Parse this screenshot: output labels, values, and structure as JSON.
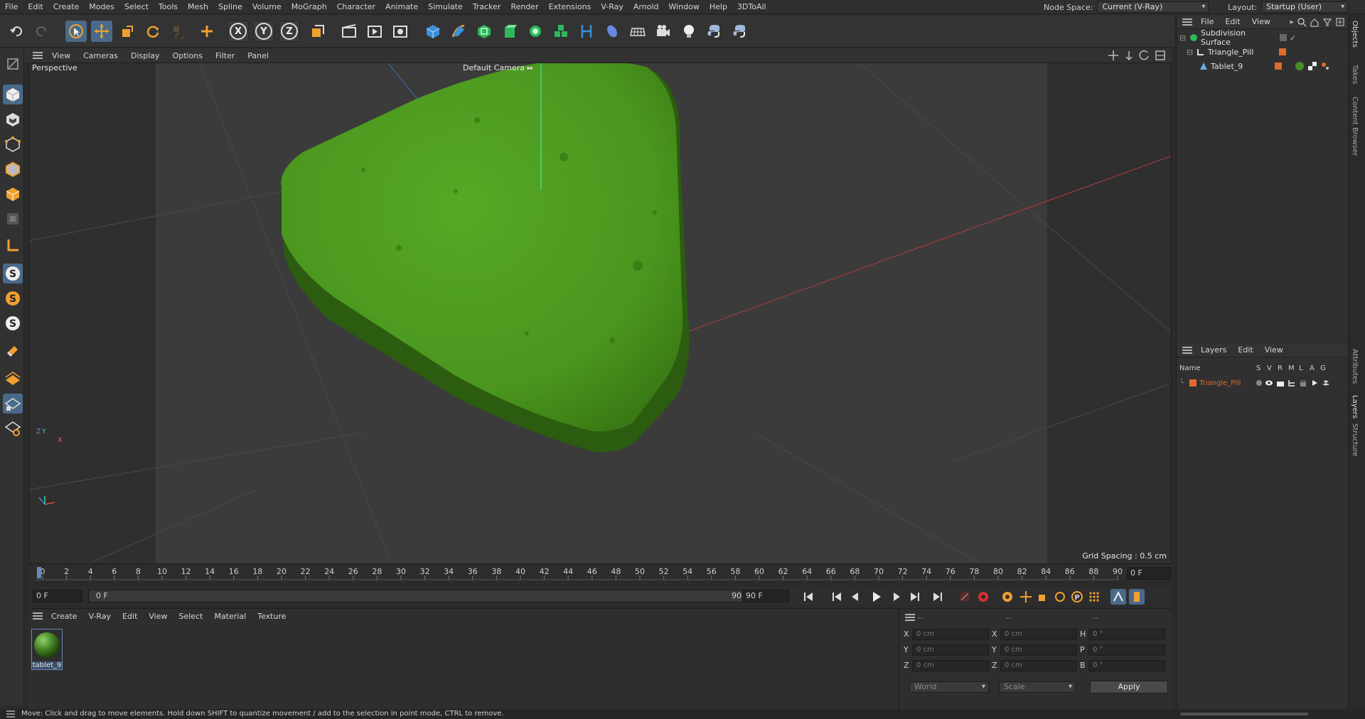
{
  "menu": [
    "File",
    "Edit",
    "Create",
    "Modes",
    "Select",
    "Tools",
    "Mesh",
    "Spline",
    "Volume",
    "MoGraph",
    "Character",
    "Animate",
    "Simulate",
    "Tracker",
    "Render",
    "Extensions",
    "V-Ray",
    "Arnold",
    "Window",
    "Help",
    "3DToAll"
  ],
  "header": {
    "node_space_label": "Node Space:",
    "node_space_value": "Current (V-Ray)",
    "layout_label": "Layout:",
    "layout_value": "Startup (User)"
  },
  "toolbar": {
    "axis_x": "X",
    "axis_y": "Y",
    "axis_z": "Z"
  },
  "viewport": {
    "menu": [
      "View",
      "Cameras",
      "Display",
      "Options",
      "Filter",
      "Panel"
    ],
    "view_name": "Perspective",
    "camera_name": "Default Camera",
    "grid_spacing": "Grid Spacing : 0.5 cm",
    "gizmo_y": "Y",
    "gizmo_z": "Z",
    "gizmo_x": "X"
  },
  "objects_panel": {
    "menu": [
      "File",
      "Edit",
      "View"
    ],
    "items": [
      {
        "name": "Subdivision Surface"
      },
      {
        "name": "Triangle_Pill"
      },
      {
        "name": "Tablet_9"
      }
    ]
  },
  "right_tabs": [
    "Objects",
    "Takes",
    "Content Browser",
    "Attributes",
    "Layers",
    "Structure"
  ],
  "layers_panel": {
    "menu": [
      "Layers",
      "Edit",
      "View"
    ],
    "col_name": "Name",
    "cols": [
      "S",
      "V",
      "R",
      "M",
      "L",
      "A",
      "G"
    ],
    "layer_name": "Triangle_Pill",
    "layer_color": "#e06a2a"
  },
  "timeline": {
    "ticks": [
      "0",
      "2",
      "4",
      "6",
      "8",
      "10",
      "12",
      "14",
      "16",
      "18",
      "20",
      "22",
      "24",
      "26",
      "28",
      "30",
      "32",
      "34",
      "36",
      "38",
      "40",
      "42",
      "44",
      "46",
      "48",
      "50",
      "52",
      "54",
      "56",
      "58",
      "60",
      "62",
      "64",
      "66",
      "68",
      "70",
      "72",
      "74",
      "76",
      "78",
      "80",
      "82",
      "84",
      "86",
      "88",
      "90"
    ],
    "current_frame": "0 F",
    "start_field": "0 F",
    "range_start": "0 F",
    "range_end": "90 F",
    "end_field": "90 F"
  },
  "material_panel": {
    "menu": [
      "Create",
      "V-Ray",
      "Edit",
      "View",
      "Select",
      "Material",
      "Texture"
    ],
    "material_name": "tablet_9"
  },
  "coords_panel": {
    "headers": [
      "--",
      "--",
      "--"
    ],
    "rows": [
      {
        "a": "X",
        "av": "0 cm",
        "b": "X",
        "bv": "0 cm",
        "c": "H",
        "cv": "0 °"
      },
      {
        "a": "Y",
        "av": "0 cm",
        "b": "Y",
        "bv": "0 cm",
        "c": "P",
        "cv": "0 °"
      },
      {
        "a": "Z",
        "av": "0 cm",
        "b": "Z",
        "bv": "0 cm",
        "c": "B",
        "cv": "0 °"
      }
    ],
    "space": "World",
    "mode": "Scale",
    "apply": "Apply"
  },
  "status": "Move: Click and drag to move elements. Hold down SHIFT to quantize movement / add to the selection in point mode, CTRL to remove.",
  "colors": {
    "pill": "#4a9a1c",
    "accent": "#e06a2a",
    "active": "#4a6a8a"
  }
}
